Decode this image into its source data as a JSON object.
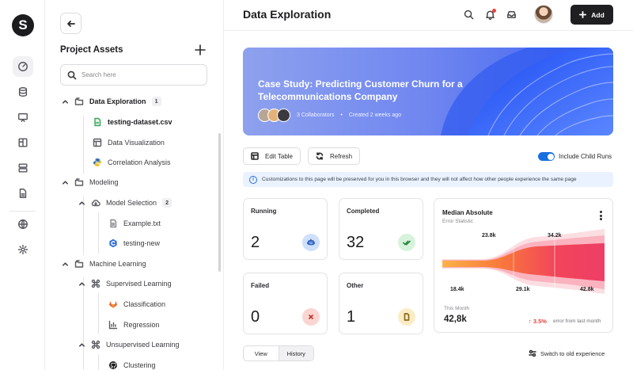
{
  "app": {
    "logo_letter": "S"
  },
  "rail": {
    "icons": [
      "gauge-icon",
      "database-icon",
      "presentation-icon",
      "layout-icon",
      "server-icon",
      "document-icon",
      "globe-icon",
      "settings-icon"
    ]
  },
  "panel": {
    "title": "Project Assets",
    "search_placeholder": "Search here",
    "tree": [
      {
        "label": "Data Exploration",
        "count": "1",
        "type": "folder"
      },
      {
        "label": "testing-dataset.csv",
        "type": "csv"
      },
      {
        "label": "Data Visualization",
        "type": "table"
      },
      {
        "label": "Correlation Analysis",
        "type": "python"
      },
      {
        "label": "Modeling",
        "type": "folder"
      },
      {
        "label": "Model Selection",
        "count": "2",
        "type": "cloud"
      },
      {
        "label": "Example.txt",
        "type": "txt"
      },
      {
        "label": "testing-new",
        "type": "app"
      },
      {
        "label": "Machine Learning",
        "type": "folder"
      },
      {
        "label": "Supervised Learning",
        "type": "command"
      },
      {
        "label": "Classification",
        "type": "gitlab"
      },
      {
        "label": "Regression",
        "type": "bar-chart"
      },
      {
        "label": "Unsupervised Learning",
        "type": "command"
      },
      {
        "label": "Clustering",
        "type": "github"
      }
    ]
  },
  "header": {
    "title": "Data Exploration",
    "add_label": "Add"
  },
  "banner": {
    "title": "Case Study: Predicting Customer Churn for a Telecommunications Company",
    "collaborators": "3 Collaborators",
    "created": "Created 2 weeks ago"
  },
  "toolbar": {
    "edit_table": "Edit Table",
    "refresh": "Refresh",
    "include_child_runs": "Include Child Runs",
    "include_child_runs_on": true
  },
  "info": {
    "text": "Customizations to this page will be preserved for you in this browser and they will not affect how other people experience the same page"
  },
  "stats": [
    {
      "title": "Running",
      "value": "2",
      "icon": "robot-icon",
      "color": "#cfe0fb",
      "stroke": "#2f5fc2"
    },
    {
      "title": "Completed",
      "value": "32",
      "icon": "double-check-icon",
      "color": "#d7f3dc",
      "stroke": "#2c8a44"
    },
    {
      "title": "Failed",
      "value": "0",
      "icon": "close-icon",
      "color": "#fbd5d2",
      "stroke": "#c0392b"
    },
    {
      "title": "Other",
      "value": "1",
      "icon": "file-icon",
      "color": "#fbecc6",
      "stroke": "#8a6a1a"
    }
  ],
  "metric": {
    "title": "Median Absolute",
    "subtitle": "Error Statistic",
    "labels": [
      "23.8k",
      "34.2k",
      "18.4k",
      "29.1k",
      "42.8k"
    ],
    "caption": "This Month",
    "value": "42,8k",
    "delta": "3.5%",
    "delta_note": "error from last month"
  },
  "bottom": {
    "tabs": [
      "View",
      "History"
    ],
    "active_tab": "History",
    "switch_label": "Switch to old experience"
  }
}
